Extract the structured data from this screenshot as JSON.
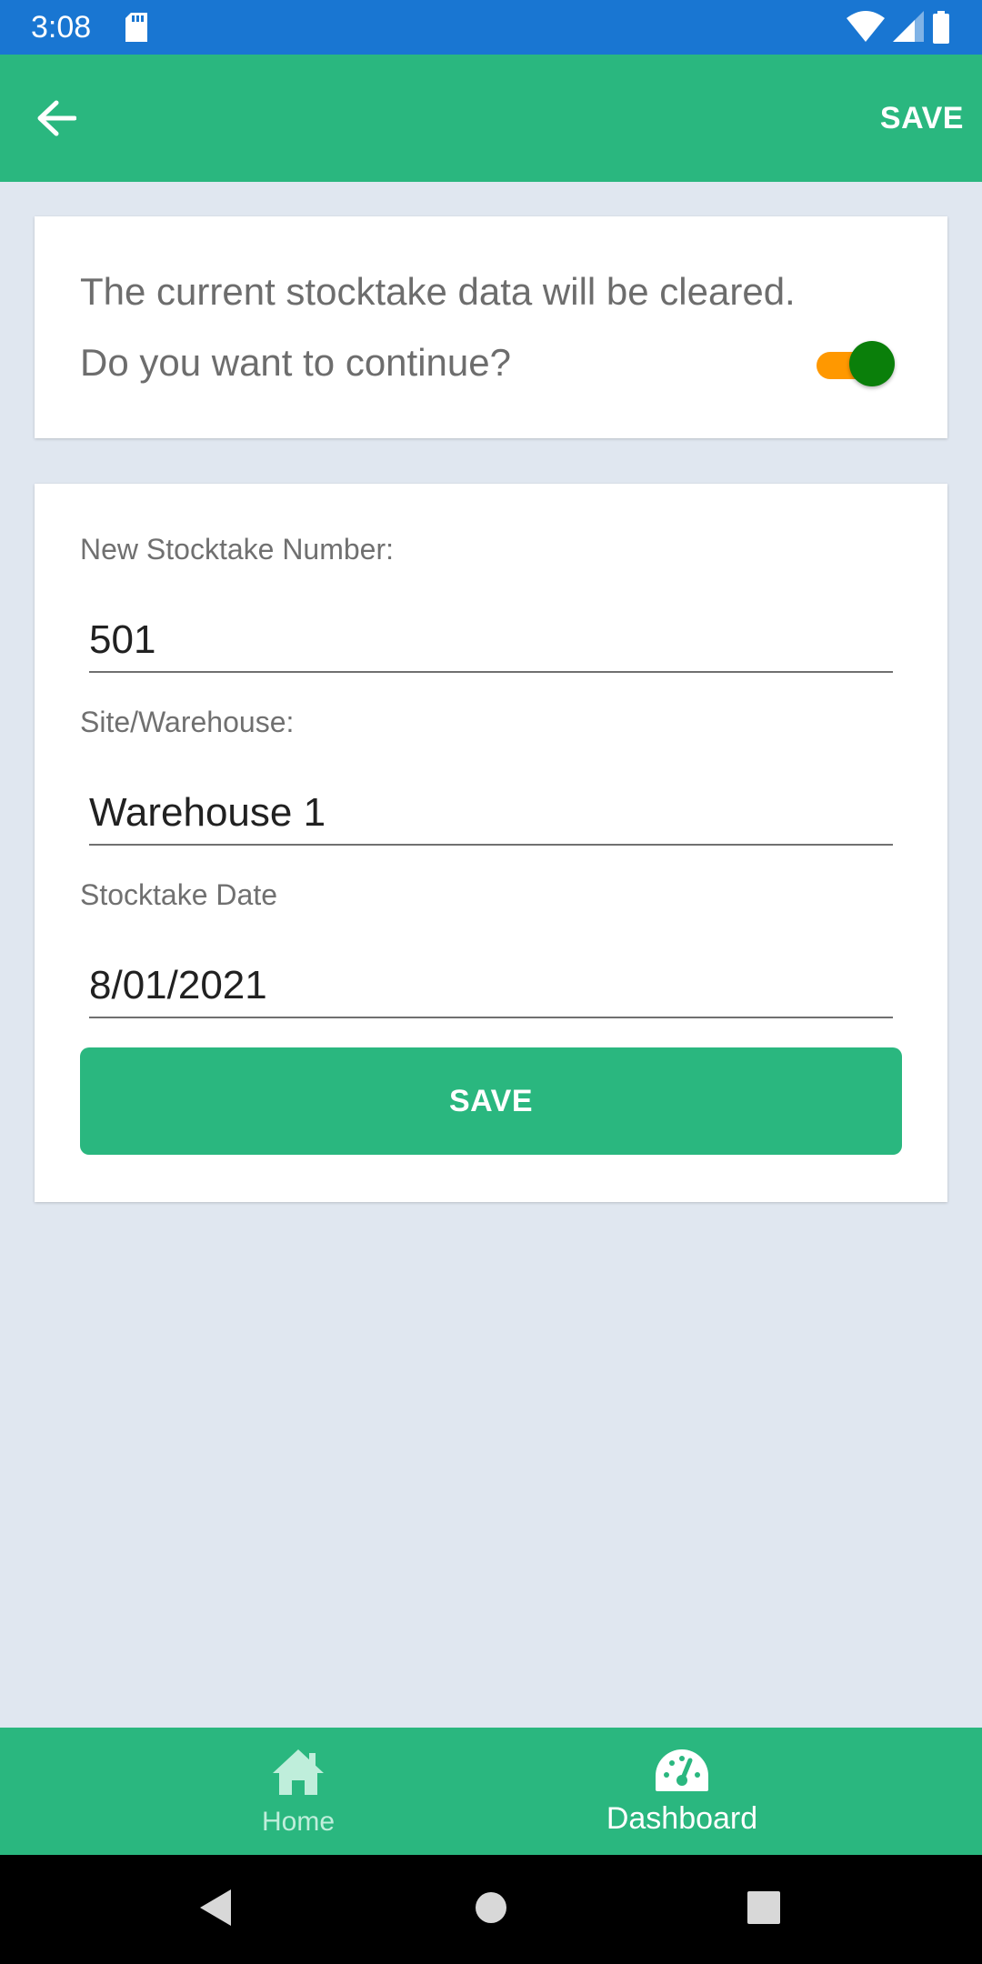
{
  "status_bar": {
    "time": "3:08"
  },
  "app_bar": {
    "back_icon": "arrow-left-icon",
    "save_label": "SAVE"
  },
  "confirm_card": {
    "line1": "The current stocktake data will be cleared.",
    "line2": "Do you want to continue?",
    "toggle_on": true,
    "toggle_track_color": "#ff9800",
    "toggle_thumb_color": "#0a7f0a"
  },
  "form": {
    "stocktake_number_label": "New Stocktake Number:",
    "stocktake_number_value": "501",
    "site_label": "Site/Warehouse:",
    "site_value": "Warehouse 1",
    "date_label": "Stocktake Date",
    "date_value": "8/01/2021",
    "save_button_label": "SAVE"
  },
  "bottom_nav": {
    "items": [
      {
        "label": "Home",
        "icon": "home-icon",
        "active": false
      },
      {
        "label": "Dashboard",
        "icon": "dashboard-icon",
        "active": true
      }
    ]
  },
  "colors": {
    "primary": "#2ab77f",
    "status_bar": "#1976d2",
    "background": "#e0e7f0"
  }
}
